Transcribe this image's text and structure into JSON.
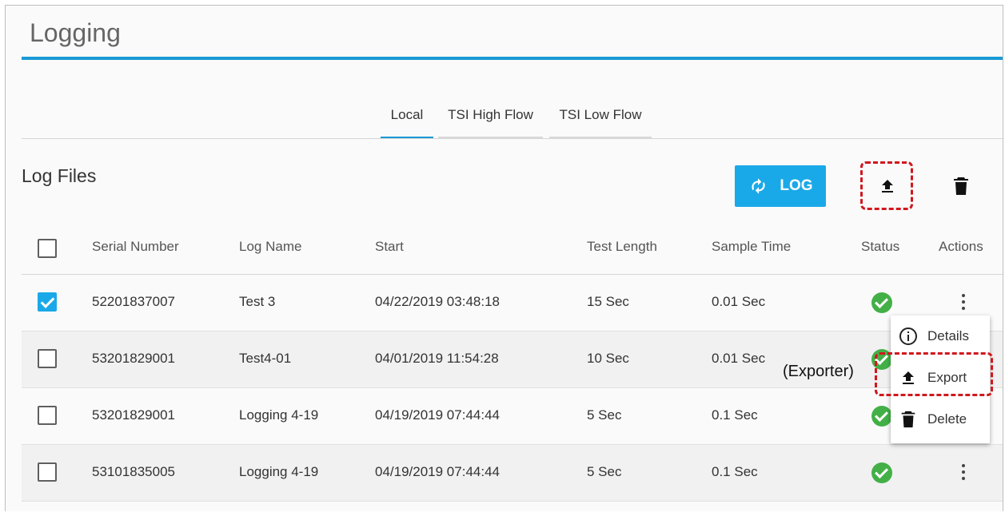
{
  "page": {
    "title": "Logging"
  },
  "tabs": [
    {
      "label": "Local",
      "active": true
    },
    {
      "label": "TSI High Flow",
      "active": false
    },
    {
      "label": "TSI Low Flow",
      "active": false
    }
  ],
  "section": {
    "title": "Log Files"
  },
  "toolbar": {
    "log_label": "LOG",
    "log_icon": "refresh-icon",
    "export_icon": "upload-icon",
    "delete_icon": "trash-icon"
  },
  "table": {
    "columns": [
      "Serial Number",
      "Log Name",
      "Start",
      "Test Length",
      "Sample Time",
      "Status",
      "Actions"
    ],
    "rows": [
      {
        "checked": true,
        "serial": "52201837007",
        "name": "Test 3",
        "start": "04/22/2019 03:48:18",
        "length": "15 Sec",
        "sample": "0.01 Sec"
      },
      {
        "checked": false,
        "serial": "53201829001",
        "name": "Test4-01",
        "start": "04/01/2019 11:54:28",
        "length": "10 Sec",
        "sample": "0.01 Sec"
      },
      {
        "checked": false,
        "serial": "53201829001",
        "name": "Logging 4-19",
        "start": "04/19/2019 07:44:44",
        "length": "5 Sec",
        "sample": "0.1 Sec"
      },
      {
        "checked": false,
        "serial": "53101835005",
        "name": "Logging 4-19",
        "start": "04/19/2019 07:44:44",
        "length": "5 Sec",
        "sample": "0.1 Sec"
      }
    ]
  },
  "context_menu": {
    "items": [
      {
        "label": "Details",
        "icon": "info-icon"
      },
      {
        "label": "Export",
        "icon": "upload-icon"
      },
      {
        "label": "Delete",
        "icon": "trash-icon"
      }
    ]
  },
  "annotation": {
    "label": "(Exporter)",
    "color": "#d0181e"
  },
  "colors": {
    "accent": "#1a9ad6",
    "button": "#1aa9e8",
    "status_ok": "#43b047"
  }
}
